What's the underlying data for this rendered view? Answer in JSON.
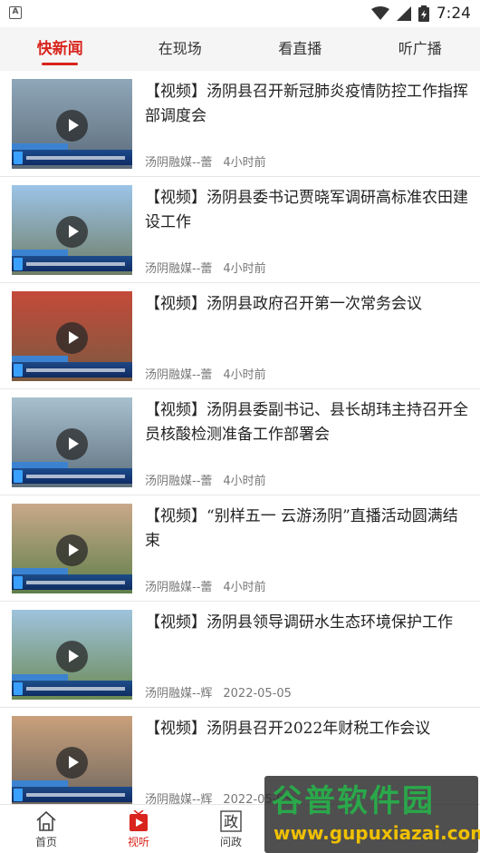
{
  "status_bar": {
    "app_icon_letter": "A",
    "time": "7:24"
  },
  "tabs": [
    {
      "label": "快新闻",
      "active": true
    },
    {
      "label": "在现场",
      "active": false
    },
    {
      "label": "看直播",
      "active": false
    },
    {
      "label": "听广播",
      "active": false
    }
  ],
  "news": [
    {
      "title": "【视频】汤阴县召开新冠肺炎疫情防控工作指挥部调度会",
      "source": "汤阴融媒--蕾",
      "time": "4小时前",
      "thumb_colors": [
        "#8fa7b9",
        "#5b6b7a"
      ]
    },
    {
      "title": "【视频】汤阴县委书记贾晓军调研高标准农田建设工作",
      "source": "汤阴融媒--蕾",
      "time": "4小时前",
      "thumb_colors": [
        "#9cc4e8",
        "#6f7d66"
      ]
    },
    {
      "title": "【视频】汤阴县政府召开第一次常务会议",
      "source": "汤阴融媒--蕾",
      "time": "4小时前",
      "thumb_colors": [
        "#c44a3a",
        "#7a5a40"
      ]
    },
    {
      "title": "【视频】汤阴县委副书记、县长胡玮主持召开全员核酸检测准备工作部署会",
      "source": "汤阴融媒--蕾",
      "time": "4小时前",
      "thumb_colors": [
        "#a8c0cf",
        "#5d6f7c"
      ]
    },
    {
      "title": "【视频】“别样五一 云游汤阴”直播活动圆满结束",
      "source": "汤阴融媒--蕾",
      "time": "4小时前",
      "thumb_colors": [
        "#c9a88a",
        "#5e7f4a"
      ]
    },
    {
      "title": "【视频】汤阴县领导调研水生态环境保护工作",
      "source": "汤阴融媒--辉",
      "time": "2022-05-05",
      "thumb_colors": [
        "#9fc3dd",
        "#6b8a55"
      ]
    },
    {
      "title": "【视频】汤阴县召开2022年财税工作会议",
      "source": "汤阴融媒--辉",
      "time": "2022-05-05",
      "thumb_colors": [
        "#c9a07a",
        "#6e6660"
      ]
    }
  ],
  "bottom_nav": [
    {
      "label": "首页",
      "icon": "home-icon",
      "active": false
    },
    {
      "label": "视听",
      "icon": "video-icon",
      "active": true
    },
    {
      "label": "问政",
      "icon": "zheng-icon",
      "icon_text": "政",
      "active": false
    }
  ],
  "watermark": {
    "main": "谷普软件园",
    "url": "www.gupuxiazai.com"
  },
  "colors": {
    "accent": "#d9251d",
    "tab_bg": "#f5f5f5"
  }
}
